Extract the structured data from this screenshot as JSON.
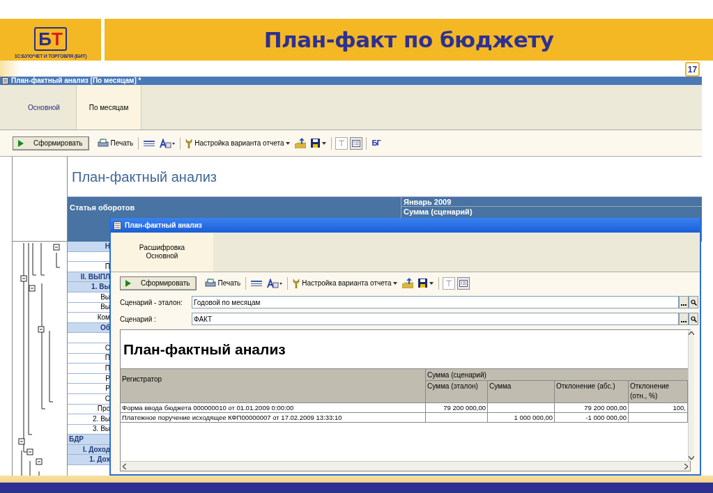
{
  "slide": {
    "logo": "БТ",
    "company": "1С:БУХУЧЕТ И ТОРГОВЛЯ (БИТ)",
    "title": "План-факт по бюджету",
    "page": "17"
  },
  "main_window": {
    "title": "План-фактный анализ [По месяцам] *",
    "tabs": [
      {
        "label": "Основной",
        "selected": false
      },
      {
        "label": "По месяцам",
        "selected": true
      }
    ],
    "toolbar": {
      "run": "Сформировать",
      "print": "Печать",
      "settings": "Настройка варианта отчета",
      "logo": "БГ"
    },
    "report": {
      "title": "План-фактный анализ",
      "column_header": "Статья оборотов",
      "period": "Январь 2009",
      "measure": "Сумма (сценарий)",
      "rows": [
        {
          "text": "Н",
          "kind": "group"
        },
        {
          "kind": "item"
        },
        {
          "text": "П",
          "kind": "item"
        },
        {
          "text": "II. ВЫПЛ",
          "kind": "group"
        },
        {
          "text": "1. Вы",
          "kind": "group"
        },
        {
          "text": "Вы",
          "kind": "item"
        },
        {
          "text": "Вы",
          "kind": "item"
        },
        {
          "text": "Ком",
          "kind": "item"
        },
        {
          "text": "Об",
          "kind": "group"
        },
        {
          "kind": "item"
        },
        {
          "text": "С",
          "kind": "item"
        },
        {
          "text": "П",
          "kind": "item"
        },
        {
          "text": "П",
          "kind": "item"
        },
        {
          "text": "Р",
          "kind": "item"
        },
        {
          "text": "Р",
          "kind": "item"
        },
        {
          "text": "С",
          "kind": "item"
        },
        {
          "text": "Про",
          "kind": "item"
        },
        {
          "text": "2. Вы",
          "kind": "item"
        },
        {
          "text": "3. Вы",
          "kind": "item"
        },
        {
          "text": "БДР",
          "kind": "section"
        },
        {
          "text": "I. Доход",
          "kind": "group"
        },
        {
          "text": "1. Дох",
          "kind": "group"
        }
      ]
    }
  },
  "detail_window": {
    "title": "План-фактный анализ",
    "tabs": [
      {
        "label": "Расшифровка Основной",
        "selected": true
      }
    ],
    "toolbar": {
      "run": "Сформировать",
      "print": "Печать",
      "settings": "Настройка варианта отчета"
    },
    "fields": [
      {
        "label": "Сценарий - эталон:",
        "value": "Годовой по месяцам"
      },
      {
        "label": "Сценарий :",
        "value": "ФАКТ"
      }
    ],
    "report": {
      "title": "План-фактный анализ",
      "columns": [
        "Регистратор",
        "Сумма (эталон)",
        "Сумма",
        "Отклонение (абс.)",
        "Отклонение (отн., %)"
      ],
      "column_group": "Сумма (сценарий)",
      "rows": [
        [
          "Форма ввода бюджета 000000010 от 01.01.2009 0:00:00",
          "79 200 000,00",
          "",
          "79 200 000,00",
          "100,"
        ],
        [
          "Платежное поручение исходящее КФП00000007 от 17.02.2009 13:33:10",
          "",
          "1 000 000,00",
          "-1 000 000,00",
          ""
        ]
      ]
    }
  }
}
